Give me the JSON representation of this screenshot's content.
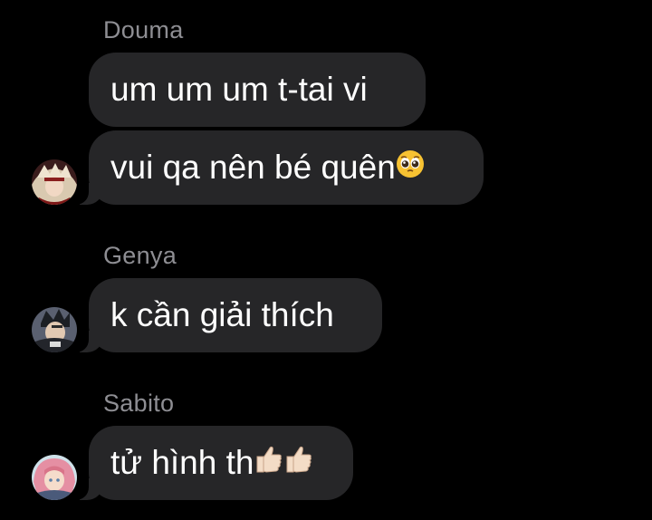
{
  "messages": [
    {
      "sender": "Douma",
      "bubbles": [
        {
          "text": "um um um t-tai vi"
        },
        {
          "text": "vui qa nên bé quên",
          "emoji": "pleading-face-icon"
        }
      ],
      "avatar": "douma-avatar"
    },
    {
      "sender": "Genya",
      "bubbles": [
        {
          "text": "k cần giải thích"
        }
      ],
      "avatar": "genya-avatar"
    },
    {
      "sender": "Sabito",
      "bubbles": [
        {
          "text": "tử hình th",
          "emoji": "thumbs-up-icon"
        }
      ],
      "avatar": "sabito-avatar"
    }
  ],
  "colors": {
    "background": "#000000",
    "bubble": "#262628",
    "sender_name": "#8e8e93",
    "text": "#ffffff"
  }
}
